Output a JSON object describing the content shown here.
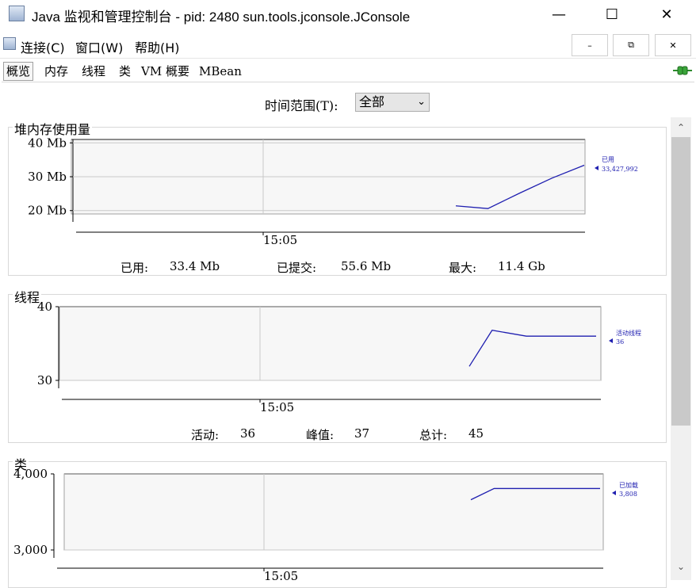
{
  "window": {
    "title": "Java 监视和管理控制台 - pid: 2480 sun.tools.jconsole.JConsole"
  },
  "menubar": {
    "items": [
      "连接(C)",
      "窗口(W)",
      "帮助(H)"
    ]
  },
  "tabs": [
    "概览",
    "内存",
    "线程",
    "类",
    "VM 概要",
    "MBean"
  ],
  "time_range": {
    "label": "时间范围(T):",
    "value": "全部"
  },
  "heap": {
    "title": "堆内存使用量",
    "stats": {
      "used_label": "已用:",
      "used_value": "33.4 Mb",
      "committed_label": "已提交:",
      "committed_value": "55.6 Mb",
      "max_label": "最大:",
      "max_value": "11.4 Gb"
    }
  },
  "threads": {
    "title": "线程",
    "stats": {
      "live_label": "活动:",
      "live_value": "36",
      "peak_label": "峰值:",
      "peak_value": "37",
      "total_label": "总计:",
      "total_value": "45"
    }
  },
  "classes": {
    "title": "类"
  },
  "chart_data": [
    {
      "type": "line",
      "title": "堆内存使用量",
      "ylabel": "Mb",
      "yticks": [
        "20 Mb",
        "30 Mb",
        "40 Mb"
      ],
      "ylim": [
        19,
        41
      ],
      "xticks": [
        "15:05"
      ],
      "x": [
        0.0,
        0.25,
        0.5,
        0.75,
        1.0
      ],
      "series": [
        {
          "name": "已用",
          "values": [
            21.4,
            20.6,
            25.2,
            29.6,
            33.4
          ]
        }
      ],
      "value_label": "33,427,992",
      "grid": true
    },
    {
      "type": "line",
      "title": "线程",
      "yticks": [
        "30",
        "40"
      ],
      "ylim": [
        30,
        40
      ],
      "xticks": [
        "15:05"
      ],
      "x": [
        0.0,
        0.18,
        0.45,
        1.0
      ],
      "series": [
        {
          "name": "活动线程",
          "values": [
            31.9,
            36.8,
            36.0,
            36.0
          ]
        }
      ],
      "value_label": "36",
      "grid": true
    },
    {
      "type": "line",
      "title": "类",
      "yticks": [
        "3,000",
        "4,000"
      ],
      "ylim": [
        3000,
        4000
      ],
      "xticks": [
        "15:05"
      ],
      "x": [
        0.0,
        0.18,
        1.0
      ],
      "series": [
        {
          "name": "已加载",
          "values": [
            3660,
            3808,
            3808
          ]
        }
      ],
      "value_label": "3,808",
      "grid": true
    }
  ]
}
